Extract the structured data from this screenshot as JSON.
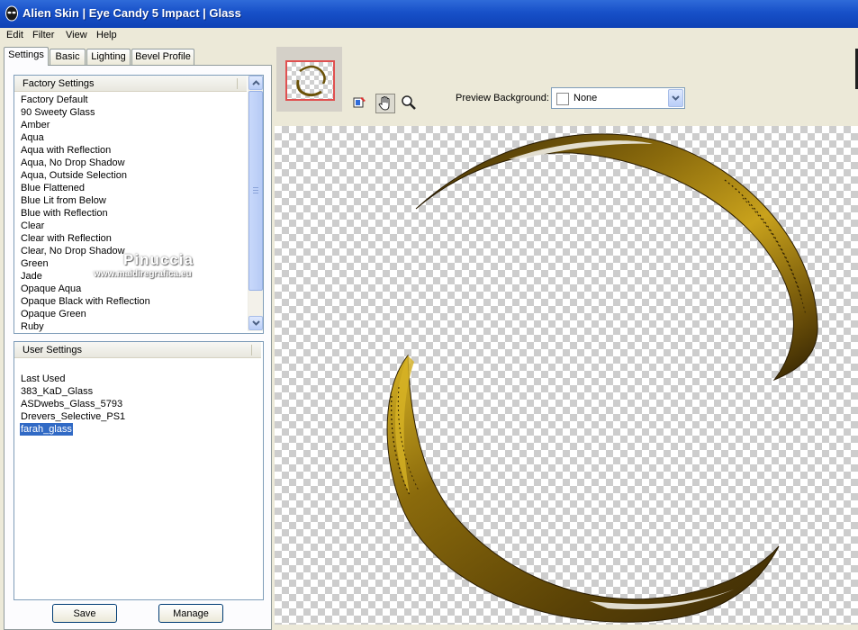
{
  "window": {
    "title": "Alien Skin | Eye Candy 5 Impact | Glass",
    "accent": "#1750c8"
  },
  "menu": [
    "Edit",
    "Filter",
    "View",
    "Help"
  ],
  "tabs": [
    "Settings",
    "Basic",
    "Lighting",
    "Bevel Profile"
  ],
  "factory_settings": {
    "header": "Factory Settings",
    "items": [
      "Factory Default",
      "90 Sweety Glass",
      "Amber",
      "Aqua",
      "Aqua with Reflection",
      "Aqua, No Drop Shadow",
      "Aqua, Outside Selection",
      "Blue Flattened",
      "Blue Lit from Below",
      "Blue with Reflection",
      "Clear",
      "Clear with Reflection",
      "Clear, No Drop Shadow",
      "Green",
      "Jade",
      "Opaque Aqua",
      "Opaque Black with Reflection",
      "Opaque Green",
      "Ruby"
    ]
  },
  "user_settings": {
    "header": "User Settings",
    "items": [
      "Last Used",
      "383_KaD_Glass",
      "ASDwebs_Glass_5793",
      "Drevers_Selective_PS1",
      "farah_glass"
    ],
    "selected": "farah_glass"
  },
  "watermark": {
    "line1": "Pinuccia",
    "line2": "www.maidiregrafica.eu"
  },
  "buttons": {
    "save": "Save",
    "manage": "Manage"
  },
  "preview": {
    "background_label": "Preview Background:",
    "background_value": "None",
    "tools": [
      "bucket-icon",
      "hand-icon",
      "zoom-icon"
    ],
    "object_color": "#8a6a0c"
  }
}
